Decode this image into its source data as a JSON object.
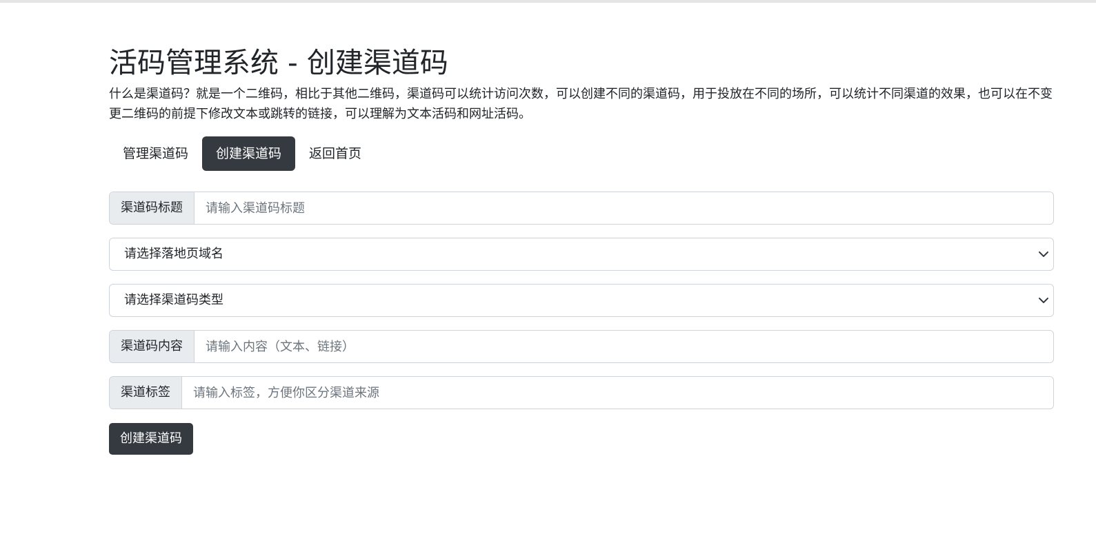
{
  "header": {
    "title": "活码管理系统 - 创建渠道码",
    "description": "什么是渠道码？就是一个二维码，相比于其他二维码，渠道码可以统计访问次数，可以创建不同的渠道码，用于投放在不同的场所，可以统计不同渠道的效果，也可以在不变更二维码的前提下修改文本或跳转的链接，可以理解为文本活码和网址活码。"
  },
  "nav": {
    "items": [
      {
        "label": "管理渠道码",
        "active": false
      },
      {
        "label": "创建渠道码",
        "active": true
      },
      {
        "label": "返回首页",
        "active": false
      }
    ]
  },
  "form": {
    "title_field": {
      "label": "渠道码标题",
      "value": "",
      "placeholder": "请输入渠道码标题"
    },
    "domain_select": {
      "selected": "请选择落地页域名"
    },
    "type_select": {
      "selected": "请选择渠道码类型"
    },
    "content_field": {
      "label": "渠道码内容",
      "value": "",
      "placeholder": "请输入内容（文本、链接）"
    },
    "tag_field": {
      "label": "渠道标签",
      "value": "",
      "placeholder": "请输入标签，方便你区分渠道来源"
    },
    "submit_label": "创建渠道码"
  },
  "colors": {
    "dark": "#343a40",
    "addon_bg": "#e9ecef",
    "border": "#ced4da",
    "placeholder": "#6c757d"
  },
  "icons": {
    "select_arrow": "chevron-down-icon"
  }
}
